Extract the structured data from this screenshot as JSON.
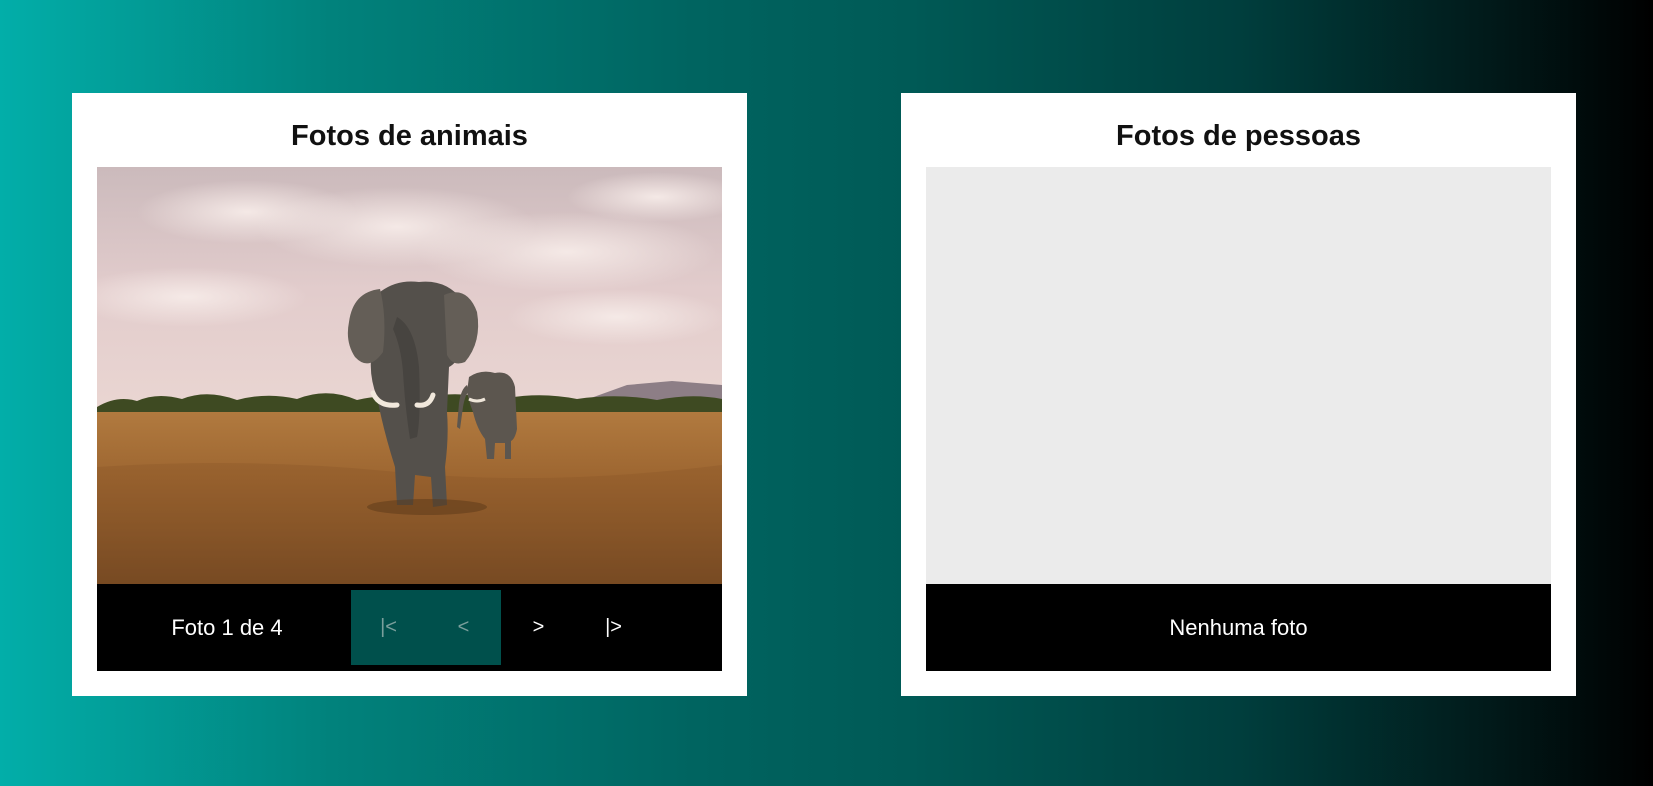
{
  "galleries": [
    {
      "title": "Fotos de animais",
      "photo": {
        "subject": "elephants-savanna-photo"
      },
      "counter": "Foto 1 de 4",
      "nav": {
        "first": "|<",
        "prev": "<",
        "next": ">",
        "last": "|>"
      }
    },
    {
      "title": "Fotos de pessoas",
      "empty_message": "Nenhuma foto"
    }
  ],
  "colors": {
    "background_start": "#02aea9",
    "background_end": "#000000",
    "disabled_button": "#00504c",
    "empty_viewer": "#ebebeb"
  }
}
